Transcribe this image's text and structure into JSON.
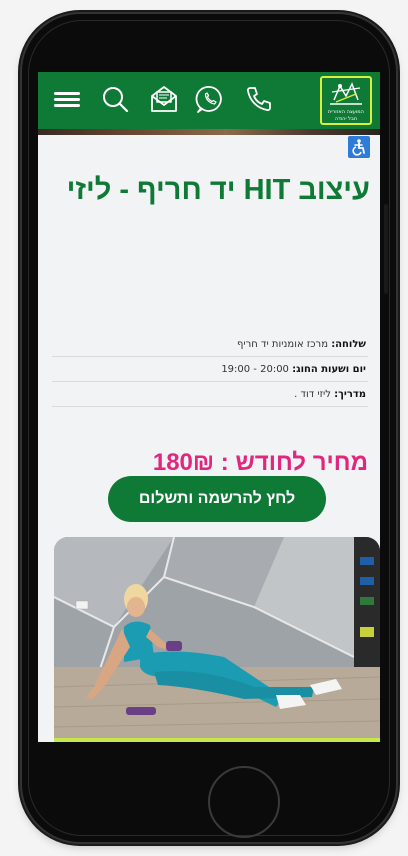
{
  "header": {
    "logo_text_line1": "המועצה האזורית",
    "logo_text_line2": "חבל יהודה"
  },
  "course": {
    "title": "עיצוב HIT יד חריף - ליזי",
    "branch_label": "שלוחה:",
    "branch_value": "מרכז אומניות יד חריף",
    "schedule_label": "יום ושעות החוג:",
    "schedule_value": "19:00 - 20:00",
    "instructor_label": "מדריך:",
    "instructor_value": "ליזי דוד ."
  },
  "price": {
    "text": "מחיר לחודש : 180₪"
  },
  "cta": {
    "label": "לחץ להרשמה ותשלום"
  },
  "colors": {
    "brand_green": "#0f7a36",
    "price_pink": "#e0267d",
    "logo_border": "#d9ef3b",
    "accessibility_blue": "#2f7bd8"
  },
  "icons": [
    "hamburger-menu-icon",
    "search-icon",
    "mail-icon",
    "whatsapp-icon",
    "phone-icon",
    "accessibility-icon"
  ]
}
